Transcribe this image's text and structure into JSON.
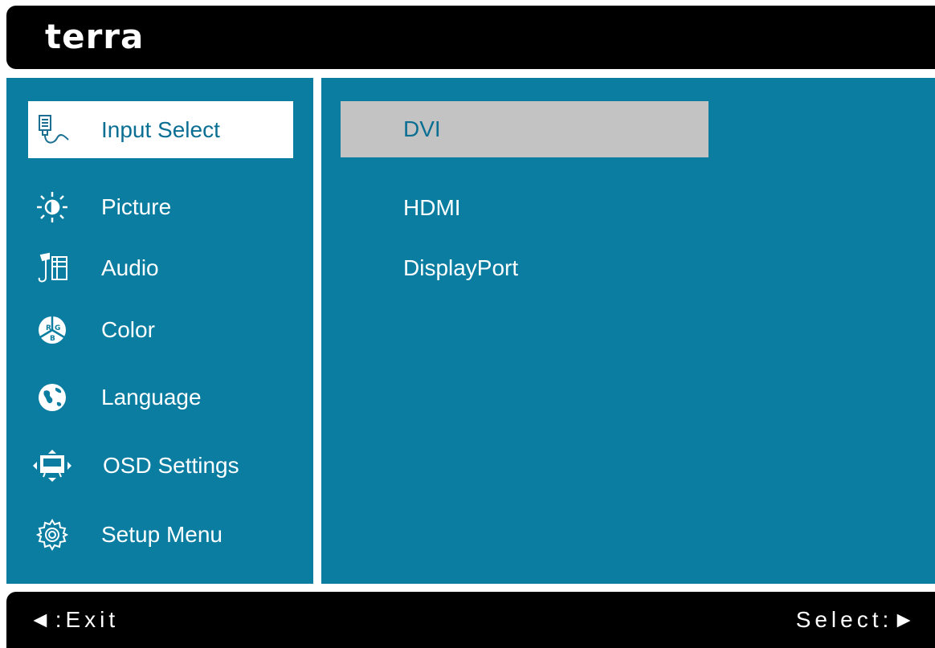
{
  "header": {
    "brand": "terra"
  },
  "sidebar": {
    "items": [
      {
        "label": "Input Select",
        "icon": "input-select-icon",
        "selected": true
      },
      {
        "label": "Picture",
        "icon": "brightness-icon"
      },
      {
        "label": "Audio",
        "icon": "music-note-icon"
      },
      {
        "label": "Color",
        "icon": "rgb-color-icon"
      },
      {
        "label": "Language",
        "icon": "globe-icon"
      },
      {
        "label": "OSD Settings",
        "icon": "osd-settings-icon"
      },
      {
        "label": "Setup Menu",
        "icon": "gear-icon"
      }
    ]
  },
  "options": {
    "items": [
      {
        "label": "DVI",
        "selected": true
      },
      {
        "label": "HDMI"
      },
      {
        "label": "DisplayPort"
      }
    ]
  },
  "footer": {
    "exit_hint": "◄:Exit",
    "select_hint": "Select:►"
  },
  "colors": {
    "panel": "#0a7da1",
    "bar": "#000000",
    "selected_menu_bg": "#ffffff",
    "selected_option_bg": "#c3c3c3",
    "selected_text": "#0a6f93"
  }
}
